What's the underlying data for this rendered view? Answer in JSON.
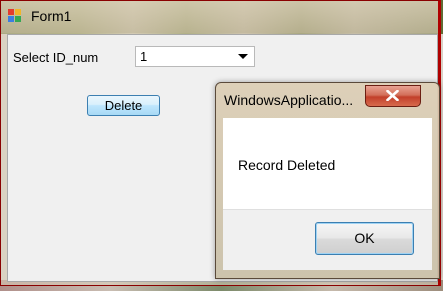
{
  "window": {
    "title": "Form1"
  },
  "form": {
    "select_label": "Select ID_num",
    "id_combo_value": "1",
    "delete_label": "Delete"
  },
  "message_box": {
    "title": "WindowsApplicatio...",
    "text": "Record Deleted",
    "ok_label": "OK"
  },
  "colors": {
    "button_border": "#3c7fb1",
    "close_button": "#c2402a",
    "window_border": "#b00000"
  }
}
